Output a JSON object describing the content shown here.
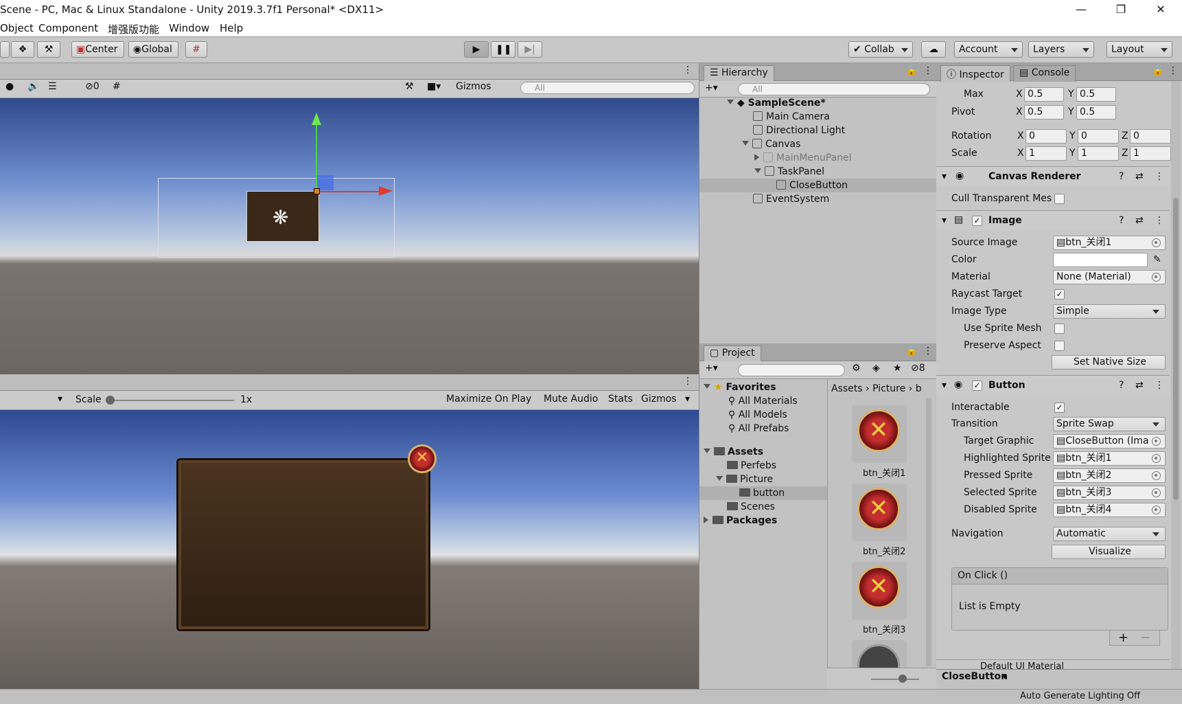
{
  "window": {
    "title": "Scene - PC, Mac & Linux Standalone - Unity 2019.3.7f1 Personal* <DX11>"
  },
  "menu": [
    "Object",
    "Component",
    "增强版功能",
    "Window",
    "Help"
  ],
  "toolbar": {
    "center": "Center",
    "global": "Global",
    "collab": "Collab",
    "account": "Account",
    "layers": "Layers",
    "layout": "Layout"
  },
  "scene_view": {
    "gizmos": "Gizmos",
    "search_placeholder": "All",
    "hidden_count": "0"
  },
  "game_view": {
    "scale_label": "Scale",
    "scale_value": "1x",
    "maximize": "Maximize On Play",
    "mute": "Mute Audio",
    "stats": "Stats",
    "gizmos": "Gizmos"
  },
  "hierarchy": {
    "tab": "Hierarchy",
    "search_placeholder": "All",
    "items": [
      {
        "label": "SampleScene*"
      },
      {
        "label": "Main Camera"
      },
      {
        "label": "Directional Light"
      },
      {
        "label": "Canvas"
      },
      {
        "label": "MainMenuPanel"
      },
      {
        "label": "TaskPanel"
      },
      {
        "label": "CloseButton"
      },
      {
        "label": "EventSystem"
      }
    ]
  },
  "project": {
    "tab": "Project",
    "hidden_count": "8",
    "favorites": "Favorites",
    "fav_items": [
      "All Materials",
      "All Models",
      "All Prefabs"
    ],
    "assets": "Assets",
    "asset_items": [
      "Perfebs",
      "Picture",
      "button",
      "Scenes"
    ],
    "packages": "Packages",
    "breadcrumb": [
      "Assets",
      "Picture",
      "b"
    ],
    "thumbs": [
      "btn_关闭1",
      "btn_关闭2",
      "btn_关闭3"
    ]
  },
  "inspector": {
    "tab": "Inspector",
    "console_tab": "Console",
    "rect": {
      "max_label": "Max",
      "max_x": "0.5",
      "max_y": "0.5",
      "pivot_label": "Pivot",
      "pivot_x": "0.5",
      "pivot_y": "0.5",
      "rotation_label": "Rotation",
      "rot_x": "0",
      "rot_y": "0",
      "rot_z": "0",
      "scale_label": "Scale",
      "scale_x": "1",
      "scale_y": "1",
      "scale_z": "1"
    },
    "canvas_renderer": {
      "title": "Canvas Renderer",
      "cull": "Cull Transparent Mes"
    },
    "image": {
      "title": "Image",
      "source_image_label": "Source Image",
      "source_image": "btn_关闭1",
      "color_label": "Color",
      "material_label": "Material",
      "material": "None (Material)",
      "raycast_label": "Raycast Target",
      "image_type_label": "Image Type",
      "image_type": "Simple",
      "sprite_mesh_label": "Use Sprite Mesh",
      "preserve_label": "Preserve Aspect",
      "native_size": "Set Native Size"
    },
    "button": {
      "title": "Button",
      "interactable_label": "Interactable",
      "transition_label": "Transition",
      "transition": "Sprite Swap",
      "target_label": "Target Graphic",
      "target": "CloseButton (Ima",
      "highlighted_label": "Highlighted Sprite",
      "highlighted": "btn_关闭1",
      "pressed_label": "Pressed Sprite",
      "pressed": "btn_关闭2",
      "selected_label": "Selected Sprite",
      "selected": "btn_关闭3",
      "disabled_label": "Disabled Sprite",
      "disabled": "btn_关闭4",
      "navigation_label": "Navigation",
      "navigation": "Automatic",
      "visualize": "Visualize",
      "onclick": "On Click ()",
      "list_empty": "List is Empty"
    },
    "material_footer": "Default UI Material",
    "object_name": "CloseButton"
  },
  "status": {
    "lighting": "Auto Generate Lighting Off"
  }
}
